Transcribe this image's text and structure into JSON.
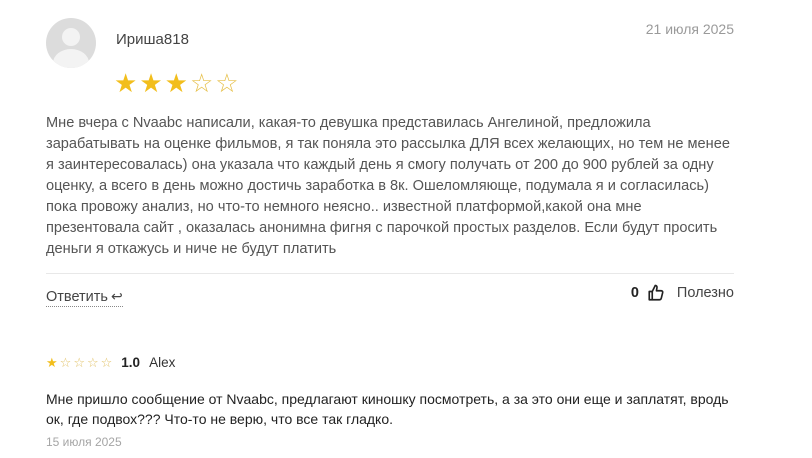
{
  "review1": {
    "username": "Ириша818",
    "date": "21 июля 2025",
    "rating": 3,
    "rating_max": 5,
    "text": "Мне вчера с Nvaabc написали, какая-то девушка представилась Ангелиной, предложила зарабатывать на оценке фильмов, я так поняла это рассылка ДЛЯ всех желающих, но тем не менее я заинтересовалась) она указала что каждый день я смогу получать от 200 до 900 рублей за одну оценку, а всего в день можно достичь заработка в 8к. Ошеломляюще, подумала я и согласилась) пока провожу анализ, но что-то немного неясно.. известной платформой,какой она мне презентовала сайт , оказалась анонимна фигня с парочкой простых разделов. Если будут просить деньги я откажусь и ниче не будут платить",
    "reply_label": "Ответить",
    "helpful_count": "0",
    "helpful_label": "Полезно",
    "star_color": "#f2be1c"
  },
  "review2": {
    "rating": 1,
    "rating_max": 5,
    "rating_text": "1.0",
    "author": "Alex",
    "text": "Мне пришло сообщение от Nvaabc, предлагают киношку посмотреть, а за это они еще и заплатят, вродь ок, где подвох??? Что-то не верю, что все так гладко.",
    "date": "15 июля 2025"
  }
}
